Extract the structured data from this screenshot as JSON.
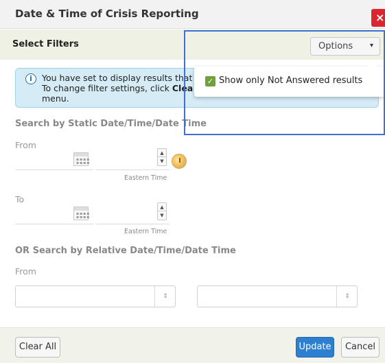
{
  "dialog": {
    "title": "Date & Time of Crisis Reporting",
    "close_label": "×"
  },
  "filter_bar": {
    "label": "Select Filters",
    "options_button": "Options",
    "options_caret": "▾"
  },
  "options_menu": {
    "checkbox_label": "Show only Not Answered results",
    "checked": true,
    "check_glyph": "✓"
  },
  "info": {
    "icon": "i",
    "line1": "You have set to display results that",
    "line2_prefix": "To change filter settings, click ",
    "line2_bold": "Clea",
    "line3": "menu."
  },
  "static_search": {
    "title": "Search by Static Date/Time/Date Time",
    "from_label": "From",
    "to_label": "To",
    "timezone_label": "Eastern Time",
    "spinner_up": "▲",
    "spinner_down": "▼"
  },
  "relative_search": {
    "title": "OR Search by Relative Date/Time/Date Time",
    "from_label": "From",
    "select_arrows": "⇕"
  },
  "footer": {
    "clear_all": "Clear All",
    "update": "Update",
    "cancel": "Cancel"
  },
  "colors": {
    "accent_blue": "#2f7fd0",
    "close_red": "#d9262f",
    "check_green": "#6fa33a",
    "info_bg": "#d5ecf7",
    "highlight_border": "#3f6fd6"
  }
}
